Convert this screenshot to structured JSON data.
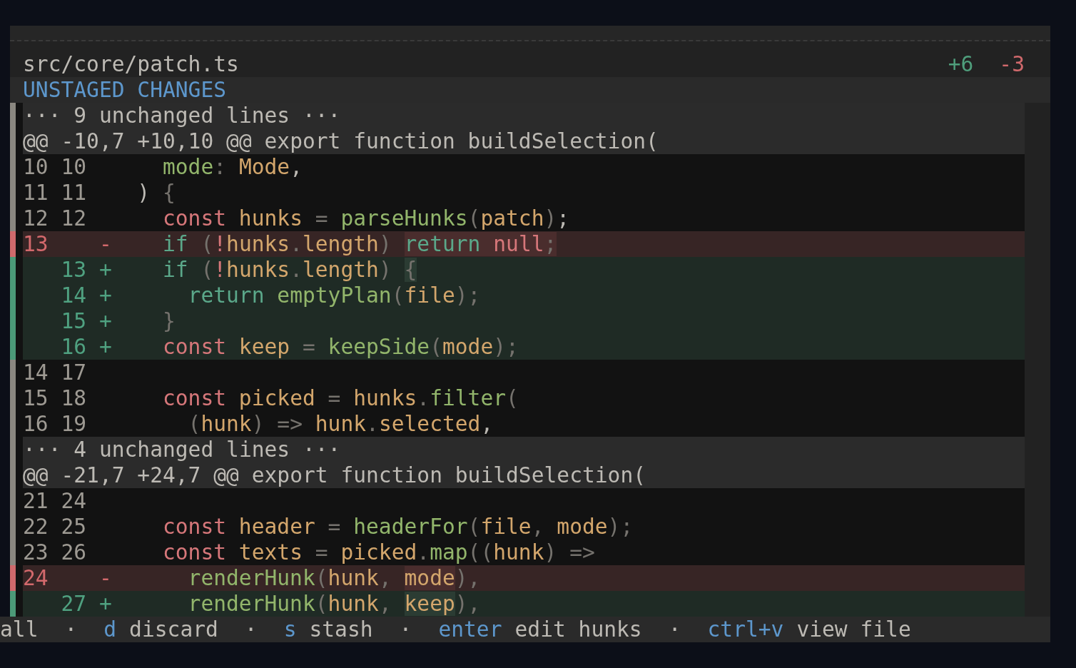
{
  "file": {
    "path": "src/core/patch.ts",
    "added": "+6",
    "removed": "-3"
  },
  "section": {
    "title": "UNSTAGED CHANGES"
  },
  "rows": [
    {
      "kind": "fold",
      "text": "··· 9 unchanged lines ···"
    },
    {
      "kind": "hunk",
      "text": "@@ -10,7 +10,10 @@ export function buildSelection("
    },
    {
      "kind": "context",
      "old": "10",
      "new": "10",
      "tokens": [
        {
          "text": "    mode",
          "kind": "fn"
        },
        {
          "text": ": ",
          "kind": "punct"
        },
        {
          "text": "Mode",
          "kind": "ident"
        },
        {
          "text": ",",
          "kind": "plain"
        }
      ]
    },
    {
      "kind": "context",
      "old": "11",
      "new": "11",
      "tokens": [
        {
          "text": "  ) ",
          "kind": "plain"
        },
        {
          "text": "{",
          "kind": "punct"
        }
      ]
    },
    {
      "kind": "context",
      "old": "12",
      "new": "12",
      "tokens": [
        {
          "text": "    const",
          "kind": "kw"
        },
        {
          "text": " hunks",
          "kind": "ident"
        },
        {
          "text": " = ",
          "kind": "punct"
        },
        {
          "text": "parseHunks",
          "kind": "fn"
        },
        {
          "text": "(",
          "kind": "punct"
        },
        {
          "text": "patch",
          "kind": "ident"
        },
        {
          "text": ")",
          "kind": "punct"
        },
        {
          "text": ";",
          "kind": "plain"
        }
      ]
    },
    {
      "kind": "del",
      "old": "13",
      "marker": "-",
      "tokens": [
        {
          "text": "    if",
          "kind": "ctl"
        },
        {
          "text": " (",
          "kind": "punct"
        },
        {
          "text": "!",
          "kind": "kw"
        },
        {
          "text": "hunks",
          "kind": "ident"
        },
        {
          "text": ".",
          "kind": "punct"
        },
        {
          "text": "length",
          "kind": "ident"
        },
        {
          "text": ") ",
          "kind": "punct"
        },
        {
          "text": "return ",
          "kind": "ctl",
          "changed": true
        },
        {
          "text": "null",
          "kind": "kw",
          "changed": true
        },
        {
          "text": ";",
          "kind": "punct",
          "changed": true
        }
      ]
    },
    {
      "kind": "add",
      "new": "13",
      "marker": "+",
      "tokens": [
        {
          "text": "    if",
          "kind": "ctl"
        },
        {
          "text": " (",
          "kind": "punct"
        },
        {
          "text": "!",
          "kind": "kw"
        },
        {
          "text": "hunks",
          "kind": "ident"
        },
        {
          "text": ".",
          "kind": "punct"
        },
        {
          "text": "length",
          "kind": "ident"
        },
        {
          "text": ") ",
          "kind": "punct"
        },
        {
          "text": "{",
          "kind": "punct",
          "changed": true
        }
      ]
    },
    {
      "kind": "add",
      "new": "14",
      "marker": "+",
      "tokens": [
        {
          "text": "      return",
          "kind": "ctl"
        },
        {
          "text": " emptyPlan",
          "kind": "fn"
        },
        {
          "text": "(",
          "kind": "punct"
        },
        {
          "text": "file",
          "kind": "ident"
        },
        {
          "text": ");",
          "kind": "punct"
        }
      ]
    },
    {
      "kind": "add",
      "new": "15",
      "marker": "+",
      "tokens": [
        {
          "text": "    }",
          "kind": "punct"
        }
      ]
    },
    {
      "kind": "add",
      "new": "16",
      "marker": "+",
      "tokens": [
        {
          "text": "    const",
          "kind": "kw"
        },
        {
          "text": " keep",
          "kind": "ident"
        },
        {
          "text": " = ",
          "kind": "punct"
        },
        {
          "text": "keepSide",
          "kind": "fn"
        },
        {
          "text": "(",
          "kind": "punct"
        },
        {
          "text": "mode",
          "kind": "ident"
        },
        {
          "text": ");",
          "kind": "punct"
        }
      ]
    },
    {
      "kind": "context",
      "old": "14",
      "new": "17",
      "tokens": []
    },
    {
      "kind": "context",
      "old": "15",
      "new": "18",
      "tokens": [
        {
          "text": "    const",
          "kind": "kw"
        },
        {
          "text": " picked",
          "kind": "ident"
        },
        {
          "text": " = ",
          "kind": "punct"
        },
        {
          "text": "hunks",
          "kind": "ident"
        },
        {
          "text": ".",
          "kind": "punct"
        },
        {
          "text": "filter",
          "kind": "fn"
        },
        {
          "text": "(",
          "kind": "punct"
        }
      ]
    },
    {
      "kind": "context",
      "old": "16",
      "new": "19",
      "tokens": [
        {
          "text": "      (",
          "kind": "punct"
        },
        {
          "text": "hunk",
          "kind": "ident"
        },
        {
          "text": ") => ",
          "kind": "punct"
        },
        {
          "text": "hunk",
          "kind": "ident"
        },
        {
          "text": ".",
          "kind": "punct"
        },
        {
          "text": "selected",
          "kind": "ident"
        },
        {
          "text": ",",
          "kind": "plain"
        }
      ]
    },
    {
      "kind": "fold",
      "text": "··· 4 unchanged lines ···"
    },
    {
      "kind": "hunk",
      "text": "@@ -21,7 +24,7 @@ export function buildSelection("
    },
    {
      "kind": "context",
      "old": "21",
      "new": "24",
      "tokens": []
    },
    {
      "kind": "context",
      "old": "22",
      "new": "25",
      "tokens": [
        {
          "text": "    const",
          "kind": "kw"
        },
        {
          "text": " header",
          "kind": "ident"
        },
        {
          "text": " = ",
          "kind": "punct"
        },
        {
          "text": "headerFor",
          "kind": "fn"
        },
        {
          "text": "(",
          "kind": "punct"
        },
        {
          "text": "file",
          "kind": "ident"
        },
        {
          "text": ", ",
          "kind": "punct"
        },
        {
          "text": "mode",
          "kind": "ident"
        },
        {
          "text": ");",
          "kind": "punct"
        }
      ]
    },
    {
      "kind": "context",
      "old": "23",
      "new": "26",
      "tokens": [
        {
          "text": "    const",
          "kind": "kw"
        },
        {
          "text": " texts",
          "kind": "ident"
        },
        {
          "text": " = ",
          "kind": "punct"
        },
        {
          "text": "picked",
          "kind": "ident"
        },
        {
          "text": ".",
          "kind": "punct"
        },
        {
          "text": "map",
          "kind": "fn"
        },
        {
          "text": "((",
          "kind": "punct"
        },
        {
          "text": "hunk",
          "kind": "ident"
        },
        {
          "text": ") =>",
          "kind": "punct"
        }
      ]
    },
    {
      "kind": "del",
      "old": "24",
      "marker": "-",
      "tokens": [
        {
          "text": "      renderHunk",
          "kind": "fn"
        },
        {
          "text": "(",
          "kind": "punct"
        },
        {
          "text": "hunk",
          "kind": "ident"
        },
        {
          "text": ", ",
          "kind": "punct"
        },
        {
          "text": "mode",
          "kind": "ident",
          "changed": true
        },
        {
          "text": "),",
          "kind": "punct"
        }
      ]
    },
    {
      "kind": "add",
      "new": "27",
      "marker": "+",
      "tokens": [
        {
          "text": "      renderHunk",
          "kind": "fn"
        },
        {
          "text": "(",
          "kind": "punct"
        },
        {
          "text": "hunk",
          "kind": "ident"
        },
        {
          "text": ", ",
          "kind": "punct"
        },
        {
          "text": "keep",
          "kind": "ident",
          "changed": true
        },
        {
          "text": "),",
          "kind": "punct"
        }
      ]
    }
  ],
  "status_bar": {
    "separator": "·",
    "items": [
      {
        "label": "all"
      },
      {
        "key": "d",
        "label": "discard"
      },
      {
        "key": "s",
        "label": "stash"
      },
      {
        "key": "enter",
        "label": "edit hunks"
      },
      {
        "key": "ctrl+v",
        "label": "view file"
      }
    ]
  }
}
